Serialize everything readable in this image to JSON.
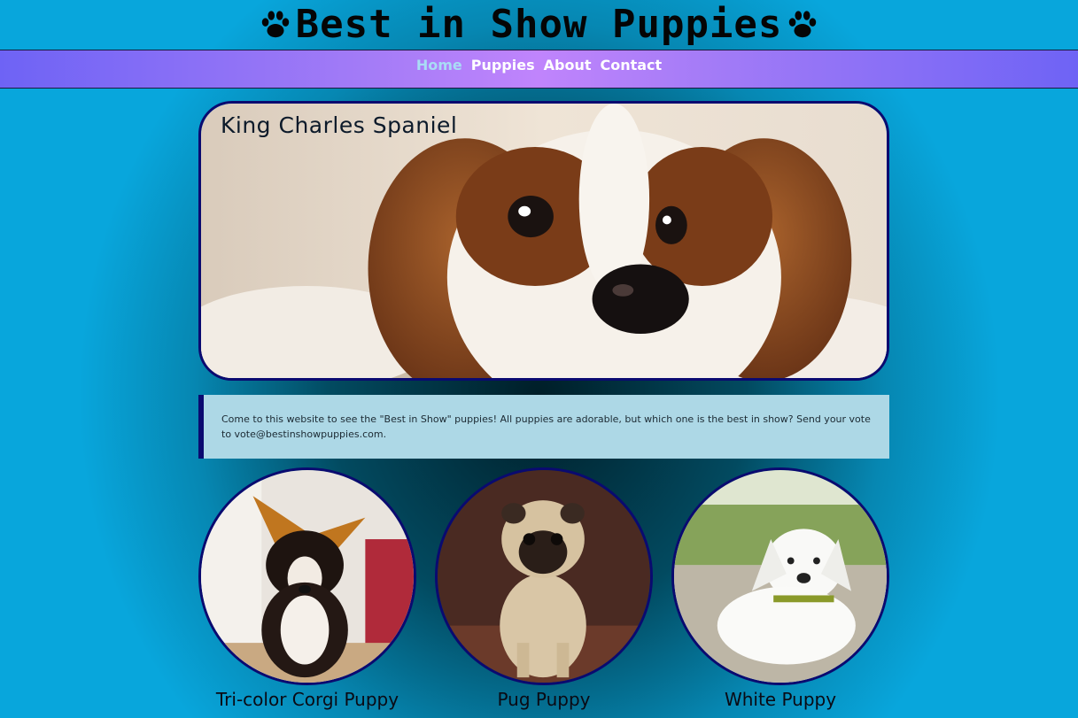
{
  "header": {
    "title": "Best in Show Puppies",
    "paw_icon": "paw-icon"
  },
  "nav": {
    "items": [
      {
        "label": "Home",
        "active": true
      },
      {
        "label": "Puppies",
        "active": false
      },
      {
        "label": "About",
        "active": false
      },
      {
        "label": "Contact",
        "active": false
      }
    ]
  },
  "hero": {
    "caption": "King Charles Spaniel"
  },
  "intro": {
    "text": "Come to this website to see the \"Best in Show\" puppies! All puppies are adorable, but which one is the best in show? Send your vote to vote@bestinshowpuppies.com."
  },
  "puppies": [
    {
      "caption": "Tri-color Corgi Puppy"
    },
    {
      "caption": "Pug Puppy"
    },
    {
      "caption": "White Puppy"
    }
  ],
  "colors": {
    "border": "#0a0a70",
    "nav_active": "#a9dcf5",
    "intro_bg": "#add8e6"
  }
}
